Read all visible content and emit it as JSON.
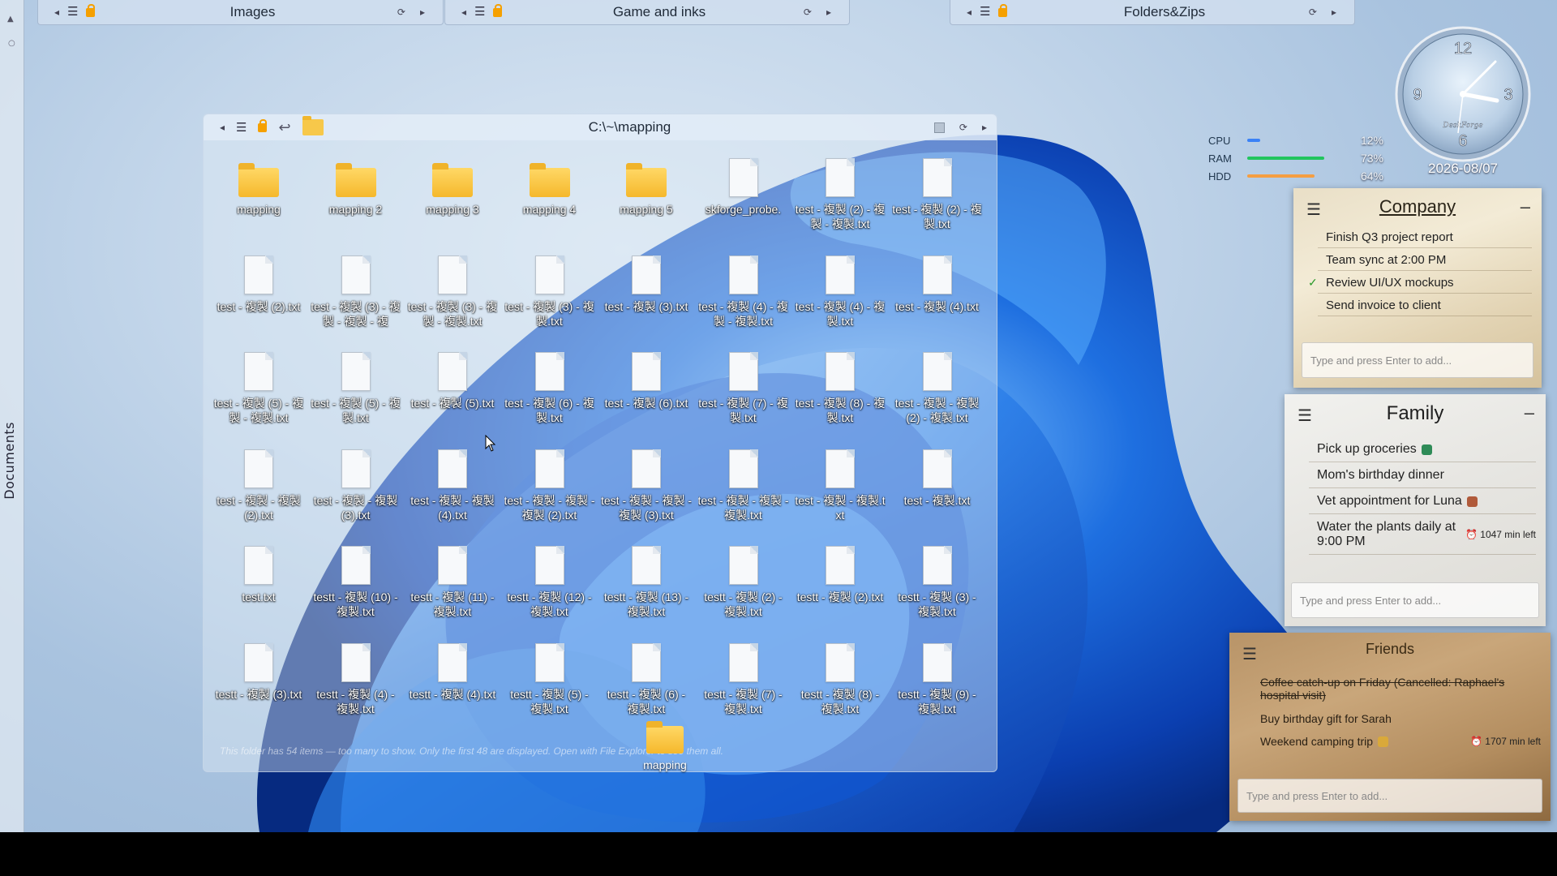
{
  "side": {
    "label": "Documents"
  },
  "topbars": [
    {
      "title": "Images"
    },
    {
      "title": "Game and inks"
    },
    {
      "title": "Folders&Zips"
    }
  ],
  "fence": {
    "path": "C:\\~\\mapping",
    "note": "This folder has 54 items — too many to show. Only the first 48 are displayed. Open with File Explorer to see them all.",
    "items": [
      {
        "label": "mapping",
        "kind": "folder"
      },
      {
        "label": "mapping 2",
        "kind": "folder"
      },
      {
        "label": "mapping 3",
        "kind": "folder"
      },
      {
        "label": "mapping 4",
        "kind": "folder"
      },
      {
        "label": "mapping 5",
        "kind": "folder"
      },
      {
        "label": "skforge_probe.",
        "kind": "file"
      },
      {
        "label": "test - 複製 (2) - 複製 - 複製.txt",
        "kind": "file"
      },
      {
        "label": "test - 複製 (2) - 複製.txt",
        "kind": "file"
      },
      {
        "label": "test - 複製 (2).txt",
        "kind": "file"
      },
      {
        "label": "test - 複製 (3) - 複製 - 複製 - 複",
        "kind": "file"
      },
      {
        "label": "test - 複製 (3) - 複製 - 複製.txt",
        "kind": "file"
      },
      {
        "label": "test - 複製 (3) - 複製.txt",
        "kind": "file"
      },
      {
        "label": "test - 複製 (3).txt",
        "kind": "file"
      },
      {
        "label": "test - 複製 (4) - 複製 - 複製.txt",
        "kind": "file"
      },
      {
        "label": "test - 複製 (4) - 複製.txt",
        "kind": "file"
      },
      {
        "label": "test - 複製 (4).txt",
        "kind": "file"
      },
      {
        "label": "test - 複製 (5) - 複製 - 複製.txt",
        "kind": "file"
      },
      {
        "label": "test - 複製 (5) - 複製.txt",
        "kind": "file"
      },
      {
        "label": "test - 複製 (5).txt",
        "kind": "file"
      },
      {
        "label": "test - 複製 (6) - 複製.txt",
        "kind": "file"
      },
      {
        "label": "test - 複製 (6).txt",
        "kind": "file"
      },
      {
        "label": "test - 複製 (7) - 複製.txt",
        "kind": "file"
      },
      {
        "label": "test - 複製 (8) - 複製.txt",
        "kind": "file"
      },
      {
        "label": "test - 複製 - 複製 (2) - 複製.txt",
        "kind": "file"
      },
      {
        "label": "test - 複製 - 複製 (2).txt",
        "kind": "file"
      },
      {
        "label": "test - 複製 - 複製 (3).txt",
        "kind": "file"
      },
      {
        "label": "test - 複製 - 複製 (4).txt",
        "kind": "file"
      },
      {
        "label": "test - 複製 - 複製 - 複製 (2).txt",
        "kind": "file"
      },
      {
        "label": "test - 複製 - 複製 - 複製 (3).txt",
        "kind": "file"
      },
      {
        "label": "test - 複製 - 複製 - 複製.txt",
        "kind": "file"
      },
      {
        "label": "test - 複製 - 複製.txt",
        "kind": "file"
      },
      {
        "label": "test - 複製.txt",
        "kind": "file"
      },
      {
        "label": "test.txt",
        "kind": "file"
      },
      {
        "label": "testt - 複製 (10) - 複製.txt",
        "kind": "file"
      },
      {
        "label": "testt - 複製 (11) - 複製.txt",
        "kind": "file"
      },
      {
        "label": "testt - 複製 (12) - 複製.txt",
        "kind": "file"
      },
      {
        "label": "testt - 複製 (13) - 複製.txt",
        "kind": "file"
      },
      {
        "label": "testt - 複製 (2) - 複製.txt",
        "kind": "file"
      },
      {
        "label": "testt - 複製 (2).txt",
        "kind": "file"
      },
      {
        "label": "testt - 複製 (3) - 複製.txt",
        "kind": "file"
      },
      {
        "label": "testt - 複製 (3).txt",
        "kind": "file"
      },
      {
        "label": "testt - 複製 (4) - 複製.txt",
        "kind": "file"
      },
      {
        "label": "testt - 複製 (4).txt",
        "kind": "file"
      },
      {
        "label": "testt - 複製 (5) - 複製.txt",
        "kind": "file"
      },
      {
        "label": "testt - 複製 (6) - 複製.txt",
        "kind": "file"
      },
      {
        "label": "testt - 複製 (7) - 複製.txt",
        "kind": "file"
      },
      {
        "label": "testt - 複製 (8) - 複製.txt",
        "kind": "file"
      },
      {
        "label": "testt - 複製 (9) - 複製.txt",
        "kind": "file"
      }
    ],
    "overlay_folder": "mapping"
  },
  "sysmon": {
    "rows": [
      {
        "label": "CPU",
        "value": "12%",
        "fraction": 0.12,
        "color": "#3b82f6"
      },
      {
        "label": "RAM",
        "value": "73%",
        "fraction": 0.73,
        "color": "#22c55e"
      },
      {
        "label": "HDD",
        "value": "64%",
        "fraction": 0.64,
        "color": "#f59e42"
      }
    ]
  },
  "clock": {
    "date": "2026-08/07",
    "brand": "DeskForge",
    "numerals": [
      "12",
      "3",
      "6",
      "9"
    ]
  },
  "notes": {
    "company": {
      "title": "Company",
      "items": [
        {
          "text": "Finish Q3 project report",
          "done": false
        },
        {
          "text": "Team sync at 2:00 PM",
          "done": false
        },
        {
          "text": "Review UI/UX mockups",
          "done": true
        },
        {
          "text": "Send invoice to client",
          "done": false
        }
      ],
      "placeholder": "Type and press Enter to add..."
    },
    "family": {
      "title": "Family",
      "items": [
        {
          "text": "Pick up groceries"
        },
        {
          "text": "Mom's birthday dinner"
        },
        {
          "text": "Vet appointment for Luna"
        },
        {
          "text": "Water the plants daily at 9:00 PM",
          "timer": "1047 min left"
        }
      ],
      "placeholder": "Type and press Enter to add..."
    },
    "friends": {
      "title": "Friends",
      "items": [
        {
          "text": "Coffee catch-up on Friday (Cancelled: Raphael's hospital visit)",
          "done": true
        },
        {
          "text": "Buy birthday gift for Sarah"
        },
        {
          "text": "Weekend camping trip",
          "timer": "1707 min left"
        }
      ],
      "placeholder": "Type and press Enter to add..."
    }
  }
}
